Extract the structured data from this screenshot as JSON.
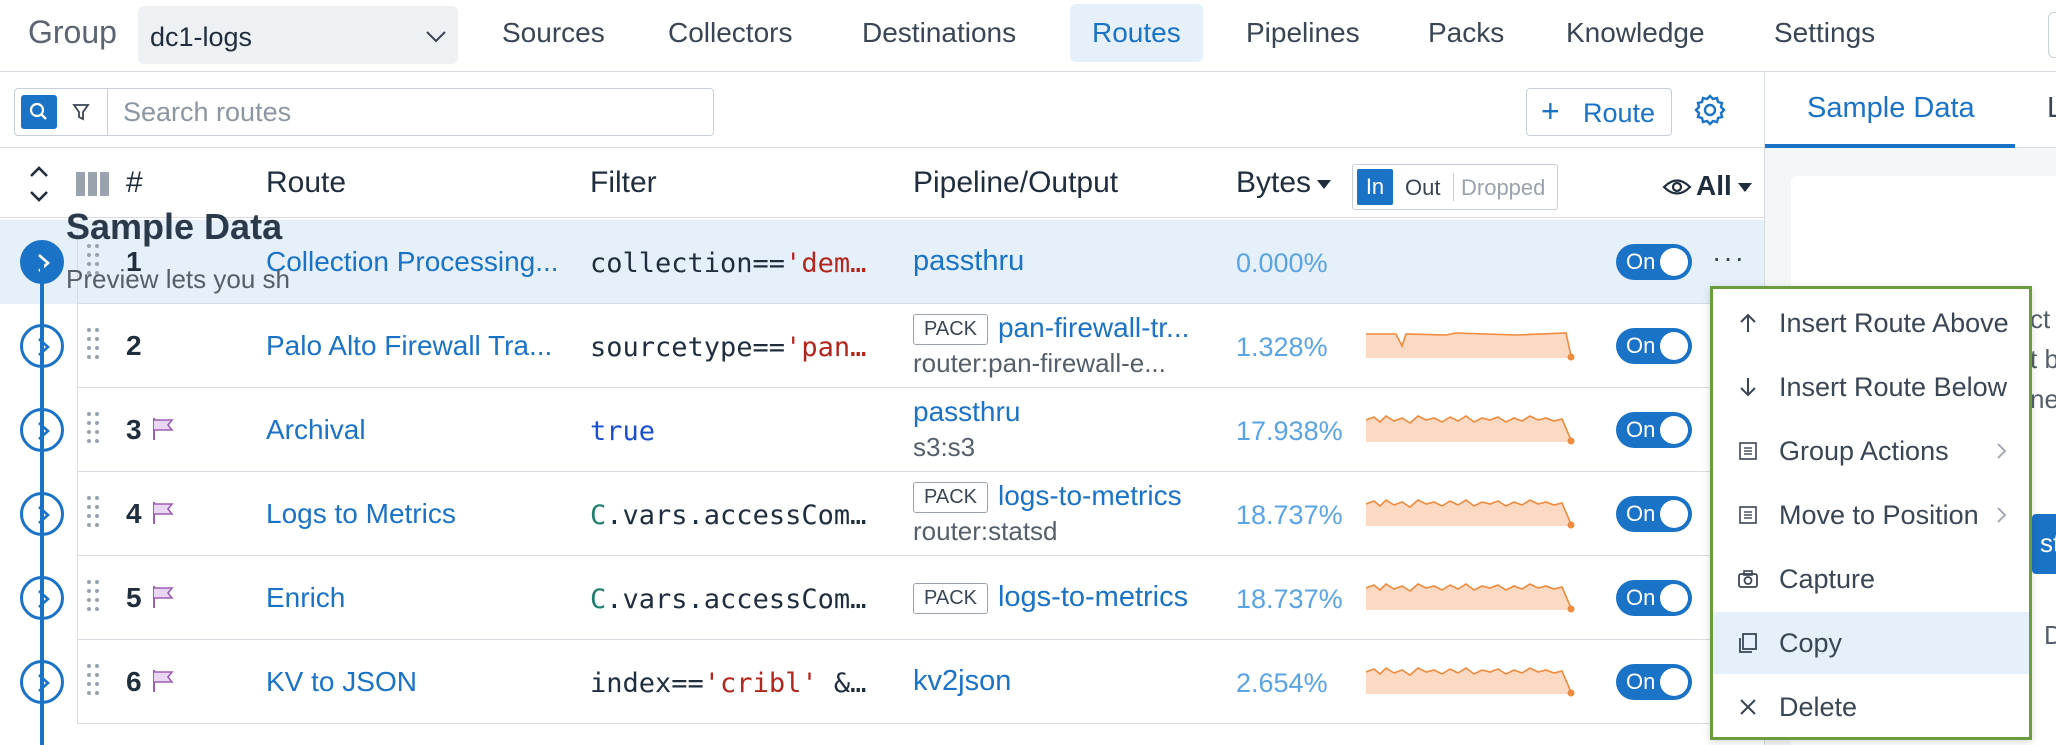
{
  "nav": {
    "group_label": "Group",
    "group_value": "dc1-logs",
    "tabs": [
      {
        "label": "Sources",
        "active": false
      },
      {
        "label": "Collectors",
        "active": false
      },
      {
        "label": "Destinations",
        "active": false
      },
      {
        "label": "Routes",
        "active": true
      },
      {
        "label": "Pipelines",
        "active": false
      },
      {
        "label": "Packs",
        "active": false
      },
      {
        "label": "Knowledge",
        "active": false
      },
      {
        "label": "Settings",
        "active": false
      }
    ]
  },
  "toolbar": {
    "search_placeholder": "Search routes",
    "add_route_label": "Route"
  },
  "table": {
    "headers": {
      "number": "#",
      "route": "Route",
      "filter": "Filter",
      "pipeline_output": "Pipeline/Output",
      "bytes": "Bytes",
      "seg_in": "In",
      "seg_out": "Out",
      "seg_dropped": "Dropped",
      "visibility": "All"
    },
    "rows": [
      {
        "num": "1",
        "name": "Collection Processing...",
        "filter": [
          {
            "t": "collection==",
            "c": ""
          },
          {
            "t": "'dem…",
            "c": "str"
          }
        ],
        "pipeline": "passthru",
        "output": "",
        "pack": "",
        "pct": "0.000%",
        "has_spark": false,
        "flag": false,
        "toggle": "On",
        "selected": true
      },
      {
        "num": "2",
        "name": "Palo Alto Firewall Tra...",
        "filter": [
          {
            "t": "sourcetype==",
            "c": ""
          },
          {
            "t": "'pan…",
            "c": "str"
          }
        ],
        "pipeline": "pan-firewall-tr...",
        "output": "router:pan-firewall-e...",
        "pack": "PACK",
        "pct": "1.328%",
        "has_spark": true,
        "flag": false,
        "toggle": "On",
        "selected": false
      },
      {
        "num": "3",
        "name": "Archival",
        "filter": [
          {
            "t": "true",
            "c": "kw"
          }
        ],
        "pipeline": "passthru",
        "output": "s3:s3",
        "pack": "",
        "pct": "17.938%",
        "has_spark": true,
        "flag": true,
        "toggle": "On",
        "selected": false
      },
      {
        "num": "4",
        "name": "Logs to Metrics",
        "filter": [
          {
            "t": "C",
            "c": "cv"
          },
          {
            "t": ".vars.accessCom…",
            "c": ""
          }
        ],
        "pipeline": "logs-to-metrics",
        "output": "router:statsd",
        "pack": "PACK",
        "pct": "18.737%",
        "has_spark": true,
        "flag": true,
        "toggle": "On",
        "selected": false
      },
      {
        "num": "5",
        "name": "Enrich",
        "filter": [
          {
            "t": "C",
            "c": "cv"
          },
          {
            "t": ".vars.accessCom…",
            "c": ""
          }
        ],
        "pipeline": "logs-to-metrics",
        "output": "",
        "pack": "PACK",
        "pct": "18.737%",
        "has_spark": true,
        "flag": true,
        "toggle": "On",
        "selected": false
      },
      {
        "num": "6",
        "name": "KV to JSON",
        "filter": [
          {
            "t": "index==",
            "c": ""
          },
          {
            "t": "'cribl'",
            "c": "str"
          },
          {
            "t": " &…",
            "c": ""
          }
        ],
        "pipeline": "kv2json",
        "output": "",
        "pack": "",
        "pct": "2.654%",
        "has_spark": true,
        "flag": true,
        "toggle": "On",
        "selected": false
      }
    ]
  },
  "context_menu": {
    "items": [
      {
        "label": "Insert Route Above",
        "icon": "arrow-up-icon",
        "submenu": false,
        "hover": false
      },
      {
        "label": "Insert Route Below",
        "icon": "arrow-down-icon",
        "submenu": false,
        "hover": false
      },
      {
        "label": "Group Actions",
        "icon": "list-icon",
        "submenu": true,
        "hover": false
      },
      {
        "label": "Move to Position",
        "icon": "list-icon",
        "submenu": true,
        "hover": false
      },
      {
        "label": "Capture",
        "icon": "camera-icon",
        "submenu": false,
        "hover": false
      },
      {
        "label": "Copy",
        "icon": "copy-icon",
        "submenu": false,
        "hover": true
      },
      {
        "label": "Delete",
        "icon": "close-icon",
        "submenu": false,
        "hover": false
      }
    ]
  },
  "right_panel": {
    "tab_active": "Sample Data",
    "tab_next": "L",
    "title": "Sample Data",
    "text_lines": [
      "Preview lets you sh",
      "ct",
      "t b",
      "ne"
    ],
    "button_fragment": "ste",
    "letter_fragment": "D"
  },
  "colors": {
    "accent": "#1a73c7",
    "menu_border": "#6b9c3e",
    "spark_fill": "#fbd9c3",
    "spark_line": "#f08a3c"
  }
}
